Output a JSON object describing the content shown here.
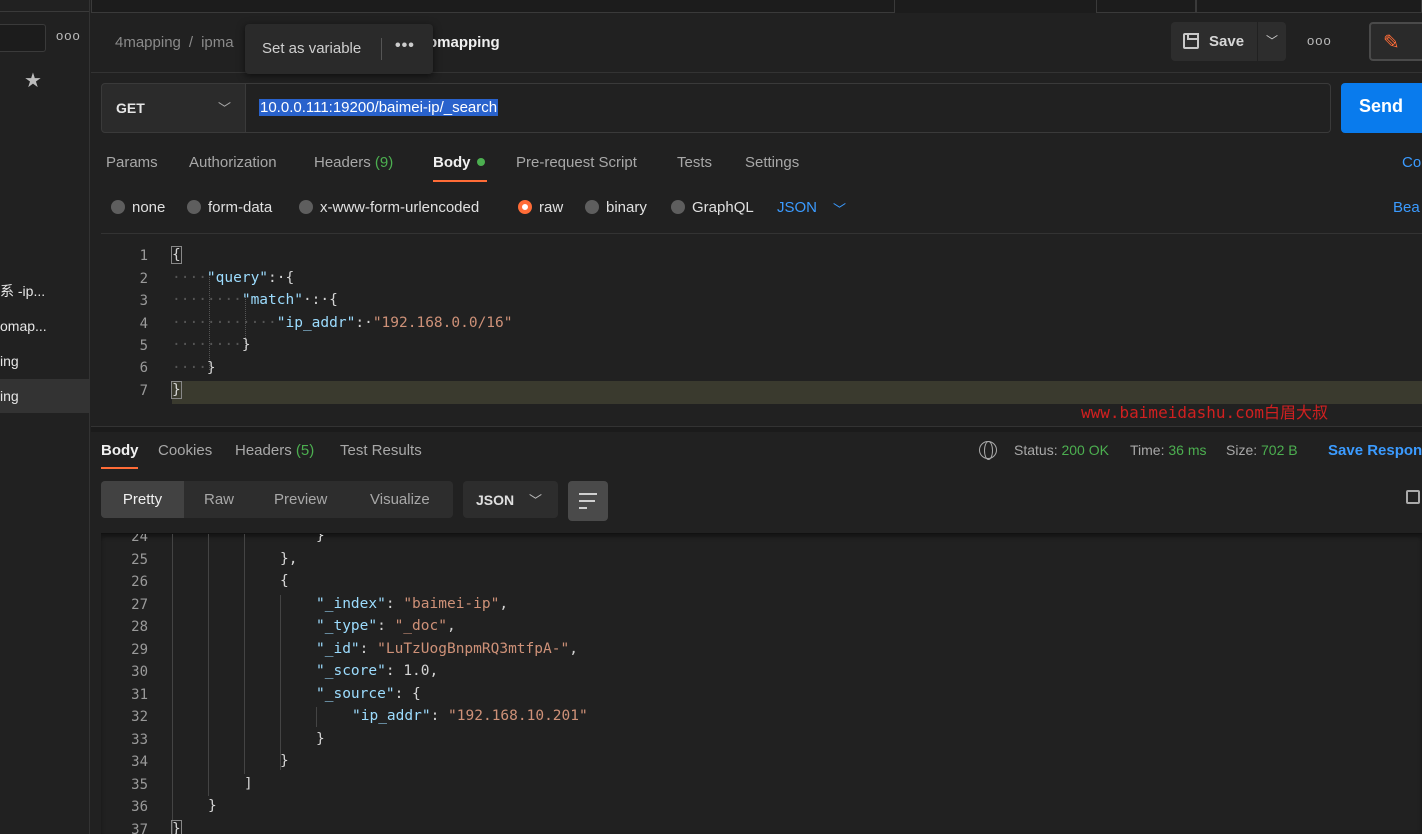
{
  "sidebar": {
    "more_label": "ooo",
    "star_icon": "star-icon",
    "items": [
      {
        "label": "系 -ip..."
      },
      {
        "label": "omap..."
      },
      {
        "label": "ing"
      },
      {
        "label": "ing"
      }
    ]
  },
  "header": {
    "breadcrumb": [
      "4mapping",
      "ipma"
    ],
    "current": "pmapping",
    "tooltip_label": "Set as variable",
    "tooltip_more": "•••",
    "save_label": "Save",
    "more_label": "ooo"
  },
  "request": {
    "method": "GET",
    "url": "10.0.0.111:19200/baimei-ip/_search",
    "send_label": "Send",
    "tabs": [
      {
        "label": "Params"
      },
      {
        "label": "Authorization"
      },
      {
        "label": "Headers",
        "count": "(9)"
      },
      {
        "label": "Body"
      },
      {
        "label": "Pre-request Script"
      },
      {
        "label": "Tests"
      },
      {
        "label": "Settings"
      }
    ],
    "cookies_label": "Co",
    "body_types": [
      "none",
      "form-data",
      "x-www-form-urlencoded",
      "raw",
      "binary",
      "GraphQL"
    ],
    "selected_body_type": "raw",
    "language": "JSON",
    "beautify_label": "Bea",
    "accent_color": "#ff6c37"
  },
  "editor": {
    "line_numbers": [
      "1",
      "2",
      "3",
      "4",
      "5",
      "6",
      "7"
    ],
    "watermark": "www.baimeidashu.com白眉大叔"
  },
  "response": {
    "tabs": [
      {
        "label": "Body"
      },
      {
        "label": "Cookies"
      },
      {
        "label": "Headers",
        "count": "(5)"
      },
      {
        "label": "Test Results"
      }
    ],
    "status_label": "Status:",
    "status_value": "200 OK",
    "time_label": "Time:",
    "time_value": "36 ms",
    "size_label": "Size:",
    "size_value": "702 B",
    "save_label": "Save Respon",
    "views": [
      "Pretty",
      "Raw",
      "Preview",
      "Visualize"
    ],
    "format": "JSON",
    "line_numbers": [
      "24",
      "25",
      "26",
      "27",
      "28",
      "29",
      "30",
      "31",
      "32",
      "33",
      "34",
      "35",
      "36",
      "37"
    ],
    "values": {
      "index": "\"baimei-ip\"",
      "type": "\"_doc\"",
      "id": "\"LuTzUogBnpmRQ3mtfpA-\"",
      "score": "1.0",
      "ip_addr": "\"192.168.10.201\""
    }
  },
  "query": {
    "ip_addr": "\"192.168.0.0/16\""
  }
}
